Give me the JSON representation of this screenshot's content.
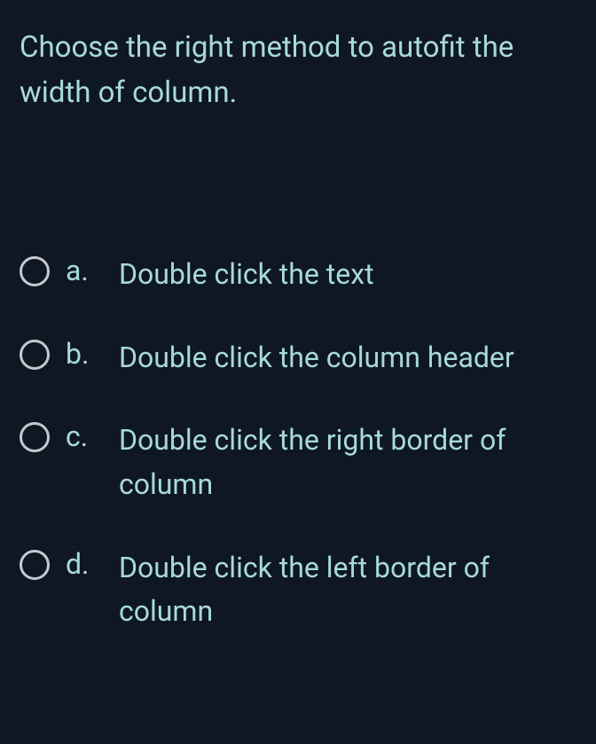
{
  "question": "Choose the right method to autofit the width of column.",
  "options": [
    {
      "letter": "a.",
      "text": "Double click the text"
    },
    {
      "letter": "b.",
      "text": "Double click the column header"
    },
    {
      "letter": "c.",
      "text": "Double click the right border of column"
    },
    {
      "letter": "d.",
      "text": "Double click the left border of column"
    }
  ]
}
